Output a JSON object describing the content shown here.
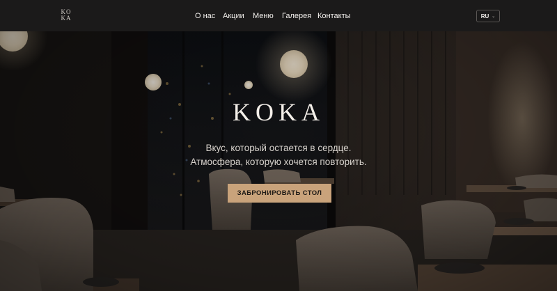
{
  "header": {
    "logo_line1": "KO",
    "logo_line2": "KA",
    "nav": [
      {
        "label": "О нас"
      },
      {
        "label": "Акции"
      },
      {
        "label": "Меню"
      },
      {
        "label": "Галерея"
      },
      {
        "label": "Контакты"
      }
    ],
    "language": "RU"
  },
  "hero": {
    "title": "KOKA",
    "tagline_line1": "Вкус, который остается в сердце.",
    "tagline_line2": "Атмосфера, которую хочется повторить.",
    "cta_label": "ЗАБРОНИРОВАТЬ СТОЛ"
  },
  "colors": {
    "header_bg": "#1b1a1a",
    "accent": "#c9a37b",
    "text_light": "#f2efec"
  }
}
